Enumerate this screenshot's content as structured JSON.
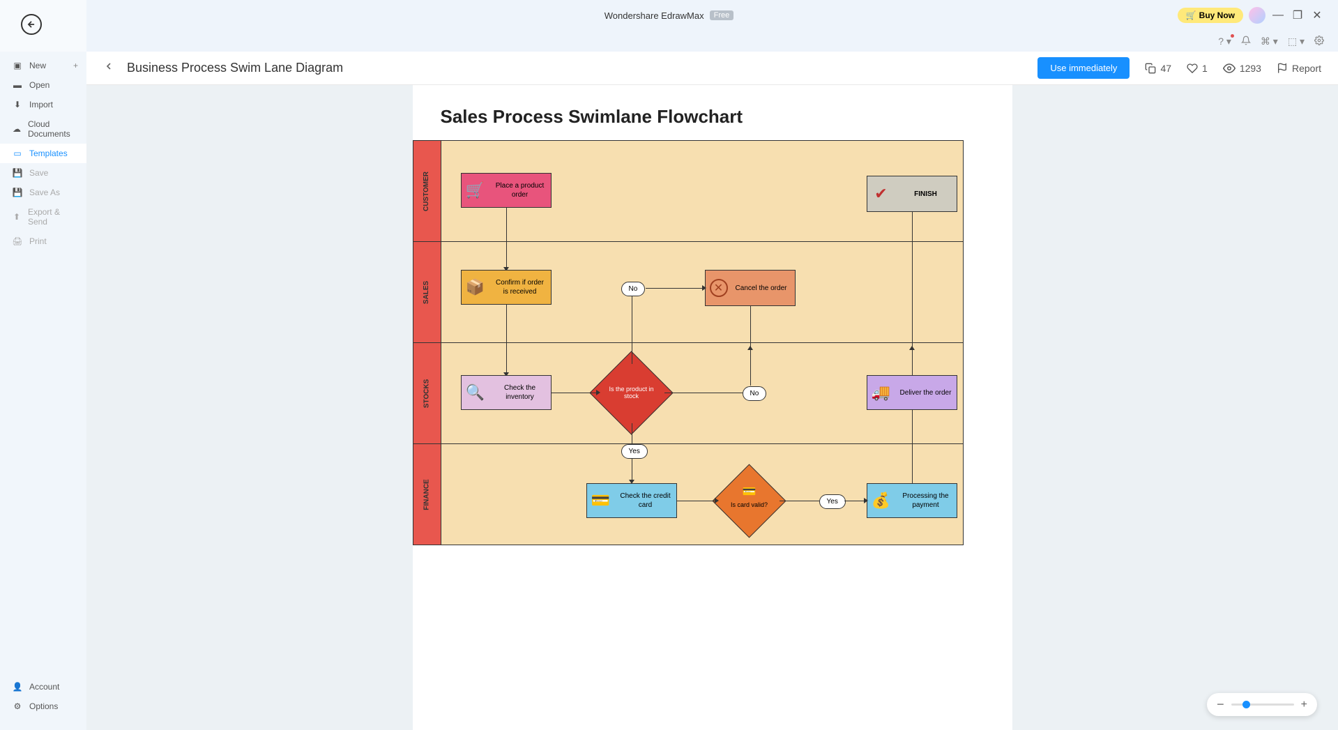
{
  "titlebar": {
    "app_name": "Wondershare EdrawMax",
    "badge": "Free",
    "buy_now": "Buy Now"
  },
  "sidebar": {
    "items": [
      {
        "label": "New",
        "icon": "plus-square"
      },
      {
        "label": "Open",
        "icon": "folder"
      },
      {
        "label": "Import",
        "icon": "download"
      },
      {
        "label": "Cloud Documents",
        "icon": "cloud"
      },
      {
        "label": "Templates",
        "icon": "templates",
        "active": true
      },
      {
        "label": "Save",
        "icon": "save",
        "disabled": true
      },
      {
        "label": "Save As",
        "icon": "save-as",
        "disabled": true
      },
      {
        "label": "Export & Send",
        "icon": "export",
        "disabled": true
      },
      {
        "label": "Print",
        "icon": "print",
        "disabled": true
      }
    ],
    "bottom": [
      {
        "label": "Account",
        "icon": "user"
      },
      {
        "label": "Options",
        "icon": "gear"
      }
    ]
  },
  "header": {
    "title": "Business Process Swim Lane Diagram",
    "use_button": "Use immediately",
    "copies": "47",
    "likes": "1",
    "views": "1293",
    "report": "Report"
  },
  "diagram": {
    "title": "Sales Process Swimlane Flowchart",
    "lanes": [
      "CUSTOMER",
      "SALES",
      "STOCKS",
      "FINANCE"
    ],
    "nodes": {
      "place_order": "Place a product order",
      "finish": "FINISH",
      "confirm": "Confirm if order is received",
      "cancel": "Cancel the order",
      "no1": "No",
      "check_inv": "Check the inventory",
      "in_stock": "Is the product in stock",
      "no2": "No",
      "deliver": "Deliver the order",
      "yes1": "Yes",
      "check_card": "Check the credit card",
      "card_valid": "Is card valid?",
      "yes2": "Yes",
      "processing": "Processing the payment"
    }
  }
}
